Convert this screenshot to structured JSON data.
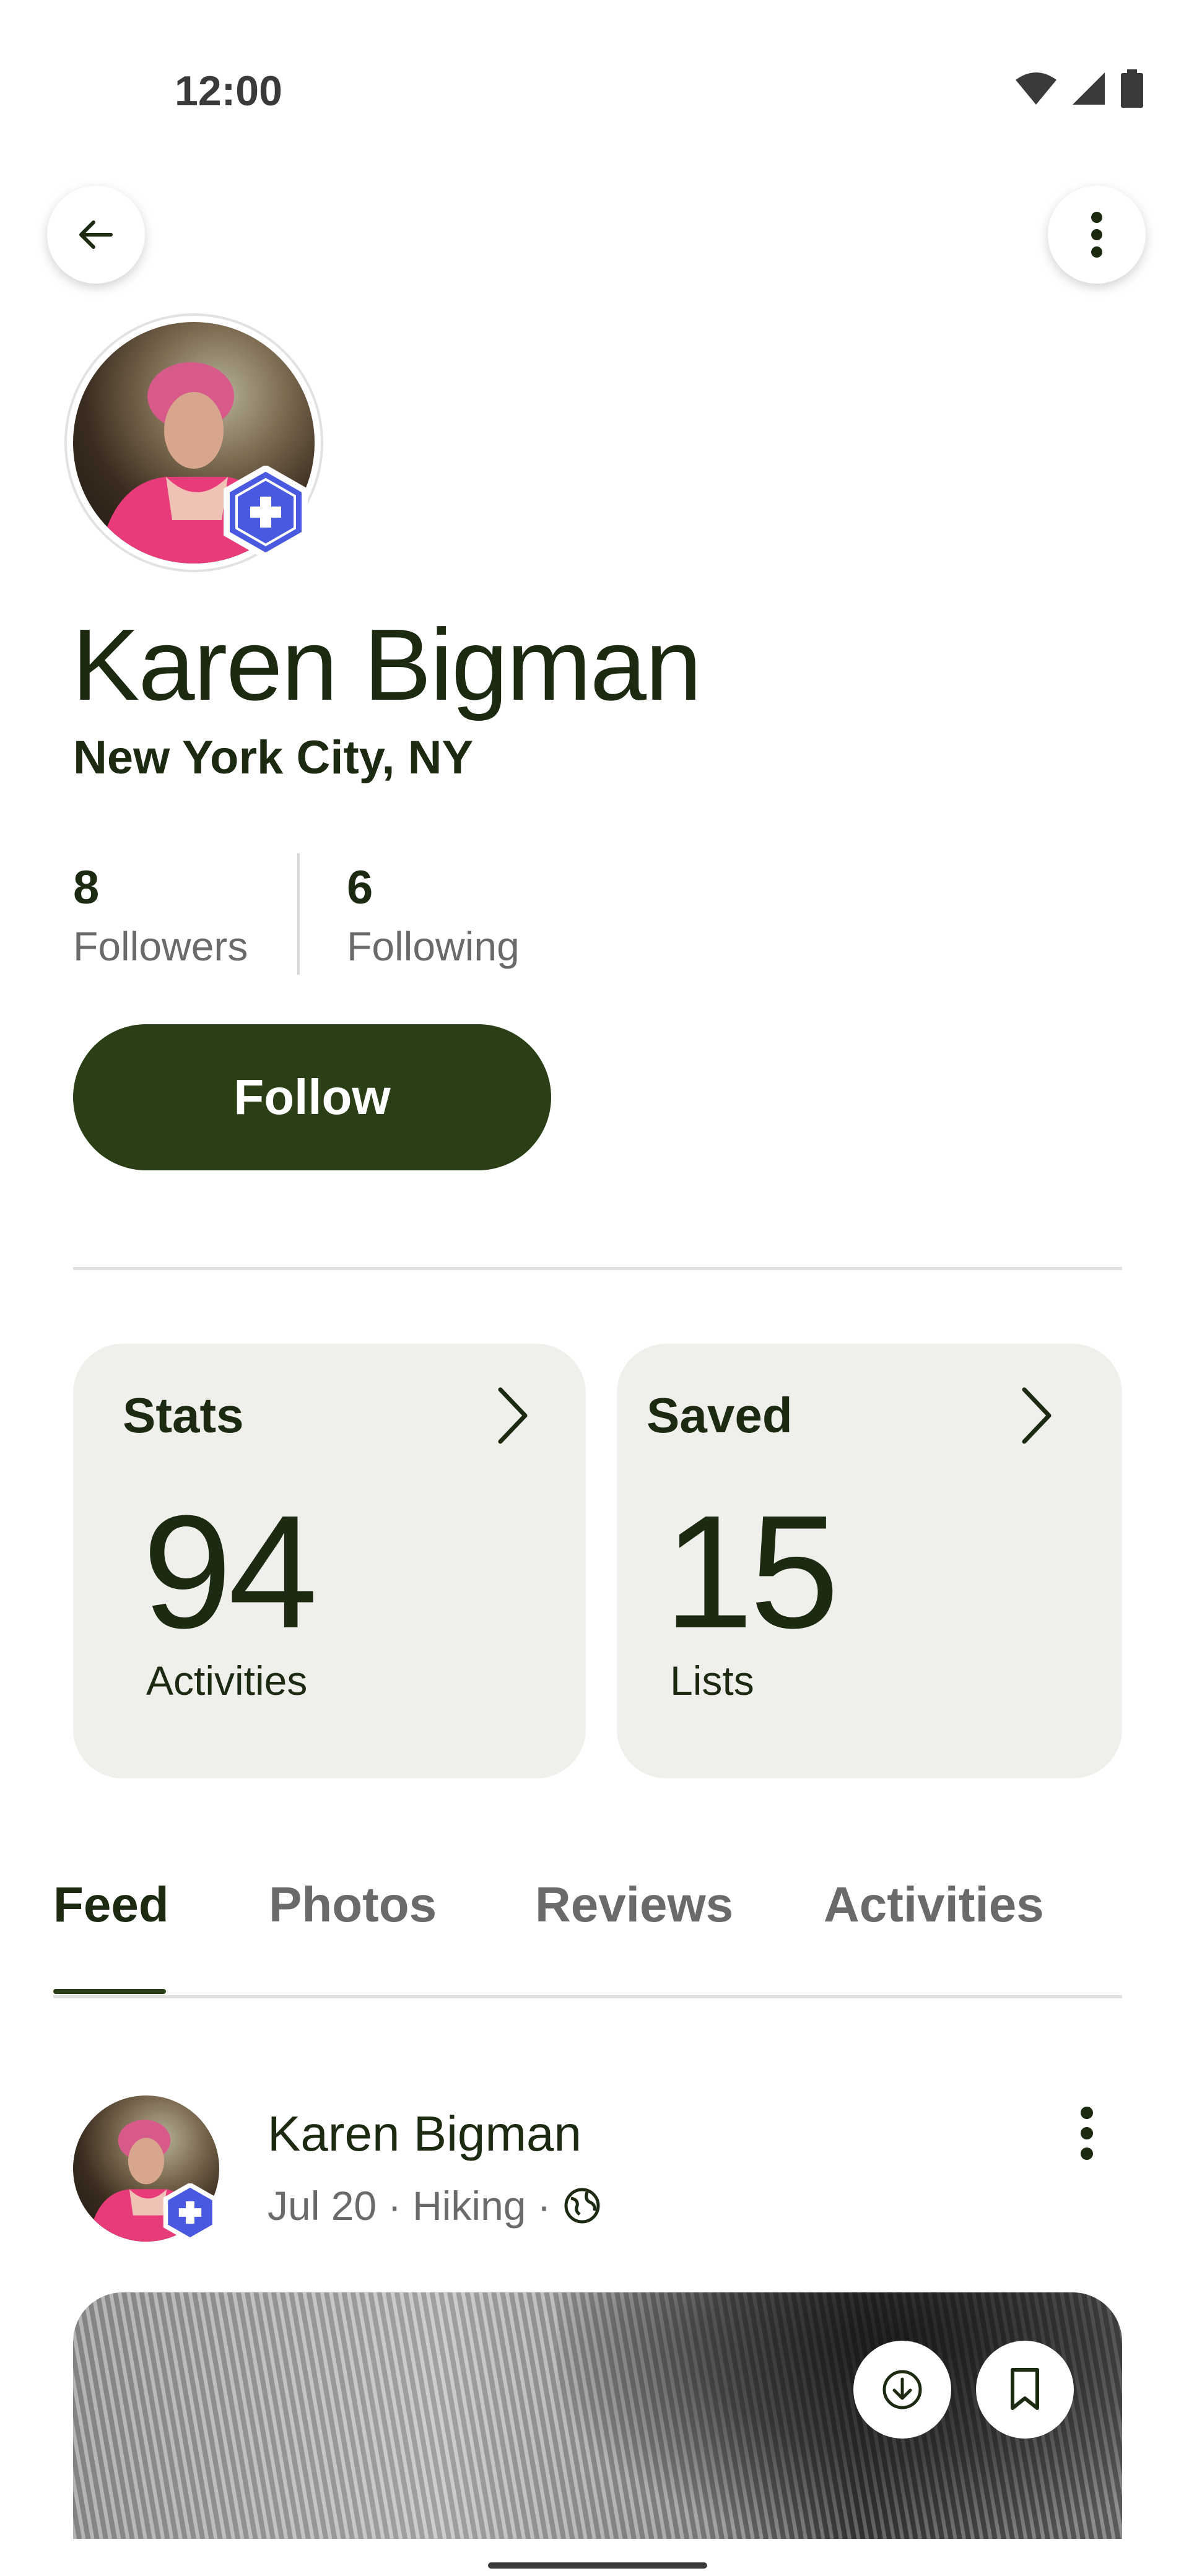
{
  "status_bar": {
    "time": "12:00",
    "icons": [
      "wifi-icon",
      "signal-icon",
      "battery-icon"
    ]
  },
  "header": {
    "back_icon": "arrow-left-icon",
    "more_icon": "more-vertical-icon"
  },
  "profile": {
    "name": "Karen Bigman",
    "location": "New York City, NY",
    "badge_icon": "plus-hexagon-icon",
    "followers_count": "8",
    "followers_label": "Followers",
    "following_count": "6",
    "following_label": "Following",
    "follow_label": "Follow"
  },
  "cards": {
    "stats": {
      "title": "Stats",
      "value": "94",
      "sub": "Activities"
    },
    "saved": {
      "title": "Saved",
      "value": "15",
      "sub": "Lists"
    }
  },
  "tabs": [
    {
      "label": "Feed",
      "active": true
    },
    {
      "label": "Photos",
      "active": false
    },
    {
      "label": "Reviews",
      "active": false
    },
    {
      "label": "Activities",
      "active": false
    }
  ],
  "post": {
    "author": "Karen Bigman",
    "date": "Jul 20",
    "activity": "Hiking",
    "separator": "·",
    "visibility_icon": "globe-icon",
    "actions": [
      "download-icon",
      "bookmark-icon"
    ]
  },
  "colors": {
    "accent": "#2b3f16",
    "text": "#1b2a10",
    "muted": "#6a6a6a",
    "card": "#efefeb",
    "badge": "#4a5ae0"
  }
}
